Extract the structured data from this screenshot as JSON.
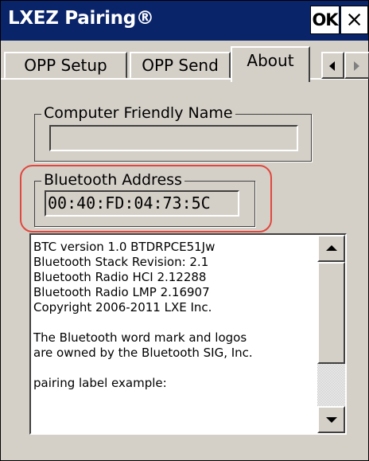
{
  "window": {
    "title": "LXEZ Pairing®",
    "ok_label": "OK",
    "close_label": "×"
  },
  "tabs": [
    {
      "label": "OPP Setup",
      "active": false
    },
    {
      "label": "OPP Send",
      "active": false
    },
    {
      "label": "About",
      "active": true
    }
  ],
  "tab_scroll": {
    "left_icon": "arrow-left-icon",
    "right_icon": "arrow-right-icon"
  },
  "computer_name": {
    "label": "Computer Friendly Name",
    "value": ""
  },
  "bluetooth_address": {
    "label": "Bluetooth Address",
    "value": "00:40:FD:04:73:5C",
    "highlight_color": "#e0473e"
  },
  "info_list": {
    "lines": [
      "BTC version 1.0 BTDRPCE51Jw",
      "Bluetooth Stack Revision: 2.1",
      "Bluetooth Radio HCI 2.12288",
      "Bluetooth Radio LMP 2.16907",
      "Copyright 2006-2011 LXE Inc.",
      "",
      "The Bluetooth word mark and logos",
      "are owned by the Bluetooth SIG, Inc.",
      "",
      "pairing label example:"
    ]
  },
  "colors": {
    "titlebar": "#0a246a",
    "face": "#d4d0c8"
  }
}
